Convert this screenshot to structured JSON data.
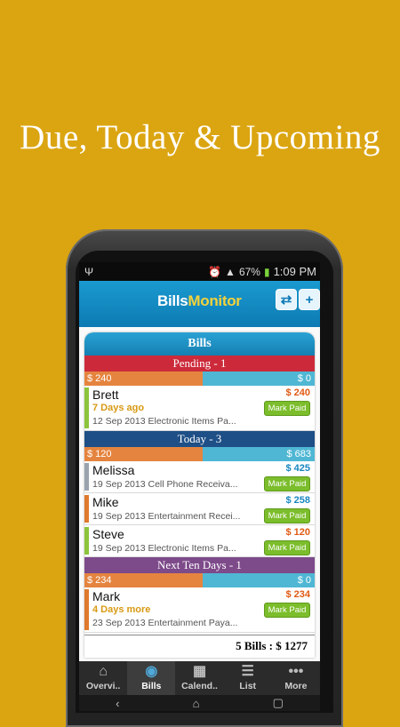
{
  "headline": "Due, Today & Upcoming",
  "status_bar": {
    "usb_icon": "usb-icon",
    "battery": "67%",
    "time": "1:09 PM"
  },
  "app_bar": {
    "logo_bills": "Bills",
    "logo_monitor": "Monitor",
    "sync_icon": "⇄",
    "add_icon": "+"
  },
  "card_title": "Bills",
  "sections": [
    {
      "title": "Pending - 1",
      "bar_left": "$ 240",
      "bar_right": "$ 0",
      "bar_fraction": 0.5,
      "items": [
        {
          "name": "Brett",
          "days": "7 Days ago",
          "date": "12 Sep 2013",
          "category": "Electronic Items",
          "status": "Pa...",
          "amount": "$ 240",
          "amount_color": "#e05a14",
          "stripe": "#8cc43c",
          "action": "Mark Paid"
        }
      ]
    },
    {
      "title": "Today - 3",
      "bar_left": "$ 120",
      "bar_right": "$ 683",
      "bar_fraction": 0.5,
      "items": [
        {
          "name": "Melissa",
          "days": "",
          "date": "19 Sep 2013",
          "category": "Cell Phone",
          "status": "Receiva...",
          "amount": "$ 425",
          "amount_color": "#1887c0",
          "stripe": "#9aa3ad",
          "action": "Mark Paid"
        },
        {
          "name": "Mike",
          "days": "",
          "date": "19 Sep 2013",
          "category": "Entertainment",
          "status": "Recei...",
          "amount": "$ 258",
          "amount_color": "#1887c0",
          "stripe": "#e07a2e",
          "action": "Mark Paid"
        },
        {
          "name": "Steve",
          "days": "",
          "date": "19 Sep 2013",
          "category": "Electronic Items",
          "status": "Pa...",
          "amount": "$ 120",
          "amount_color": "#e05a14",
          "stripe": "#8cc43c",
          "action": "Mark Paid"
        }
      ]
    },
    {
      "title": "Next Ten Days - 1",
      "bar_left": "$ 234",
      "bar_right": "$ 0",
      "bar_fraction": 0.5,
      "items": [
        {
          "name": "Mark",
          "days": "4 Days more",
          "date": "23 Sep 2013",
          "category": "Entertainment",
          "status": "Paya...",
          "amount": "$ 234",
          "amount_color": "#e05a14",
          "stripe": "#e07a2e",
          "action": "Mark Paid"
        }
      ]
    }
  ],
  "total": "5 Bills : $ 1277",
  "tabs": [
    {
      "label": "Overvi..",
      "icon": "home-icon",
      "glyph": "⌂",
      "active": false
    },
    {
      "label": "Bills",
      "icon": "eye-icon",
      "glyph": "◉",
      "active": true
    },
    {
      "label": "Calend..",
      "icon": "calendar-icon",
      "glyph": "▦",
      "active": false
    },
    {
      "label": "List",
      "icon": "list-icon",
      "glyph": "☰",
      "active": false
    },
    {
      "label": "More",
      "icon": "more-icon",
      "glyph": "•••",
      "active": false
    }
  ],
  "nav": {
    "back": "‹",
    "home": "⌂",
    "recent": "▢"
  }
}
